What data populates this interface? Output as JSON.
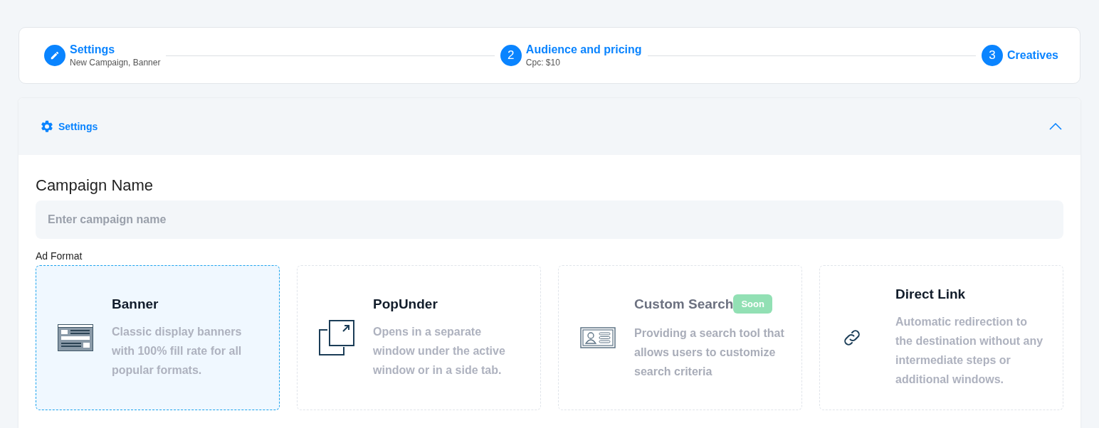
{
  "steps": [
    {
      "kind": "done",
      "title": "Settings",
      "subtitle": "New Campaign, Banner"
    },
    {
      "kind": "number",
      "number": "2",
      "title": "Audience and pricing",
      "subtitle": "Cpc: $10"
    },
    {
      "kind": "number",
      "number": "3",
      "title": "Creatives"
    }
  ],
  "panel": {
    "title": "Settings",
    "expanded": true
  },
  "campaign_name": {
    "label": "Campaign Name",
    "placeholder": "Enter campaign name"
  },
  "ad_format": {
    "label": "Ad Format",
    "options": [
      {
        "kind": "banner",
        "title": "Banner",
        "description": "Classic display banners with 100% fill rate for all popular formats.",
        "selected": true,
        "disabled": false
      },
      {
        "kind": "popunder",
        "title": "PopUnder",
        "description": "Opens in a separate window under the active window or in a side tab.",
        "selected": false,
        "disabled": false
      },
      {
        "kind": "search",
        "title": "Custom Search",
        "badge": "Soon",
        "description": "Providing a search tool that allows users to customize search criteria",
        "selected": false,
        "disabled": true
      },
      {
        "kind": "link",
        "title": "Direct Link",
        "description": "Automatic redirection to the destination without any intermediate steps or additional windows.",
        "selected": false,
        "disabled": false
      }
    ]
  }
}
